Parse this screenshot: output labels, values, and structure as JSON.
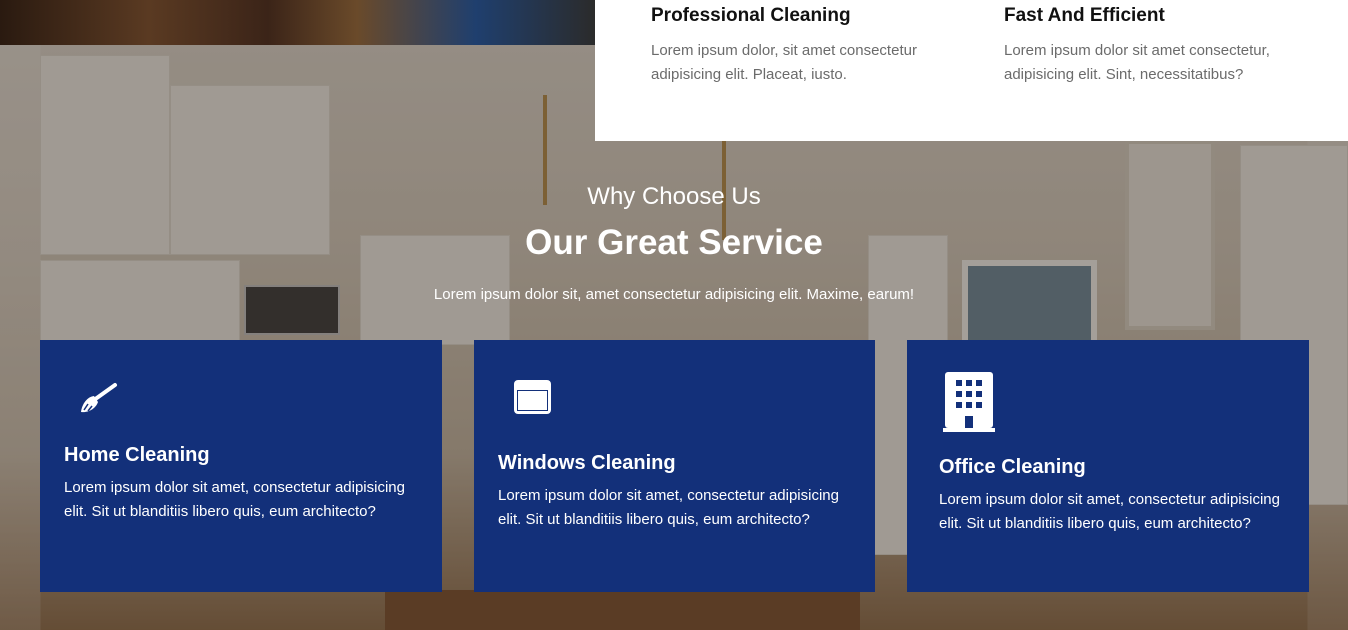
{
  "features": [
    {
      "title": "Professional Cleaning",
      "text": "Lorem ipsum dolor, sit amet consectetur adipisicing elit. Placeat, iusto."
    },
    {
      "title": "Fast And Efficient",
      "text": "Lorem ipsum dolor sit amet consectetur, adipisicing elit. Sint, necessitatibus?"
    }
  ],
  "section": {
    "kicker": "Why Choose Us",
    "title": "Our Great Service",
    "subtitle": "Lorem ipsum dolor sit, amet consectetur adipisicing elit. Maxime, earum!"
  },
  "services": [
    {
      "icon": "broom-icon",
      "title": "Home Cleaning",
      "text": "Lorem ipsum dolor sit amet, consectetur adipisicing elit. Sit ut blanditiis libero quis, eum architecto?"
    },
    {
      "icon": "window-icon",
      "title": "Windows Cleaning",
      "text": "Lorem ipsum dolor sit amet, consectetur adipisicing elit. Sit ut blanditiis libero quis, eum architecto?"
    },
    {
      "icon": "building-icon",
      "title": "Office Cleaning",
      "text": "Lorem ipsum dolor sit amet, consectetur adipisicing elit. Sit ut blanditiis libero quis, eum architecto?"
    }
  ],
  "colors": {
    "card_blue": "#13307a",
    "heading_dark": "#111111",
    "body_gray": "#6b6b6b"
  }
}
